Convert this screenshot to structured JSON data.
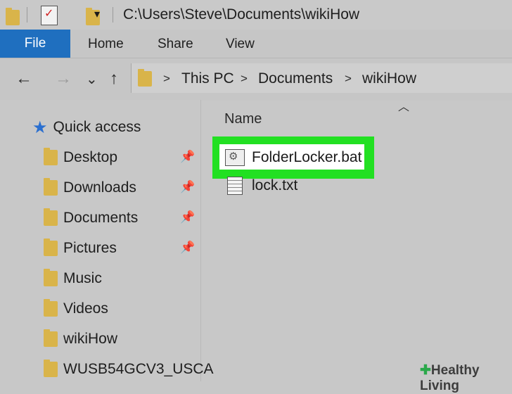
{
  "titlebar": {
    "path": "C:\\Users\\Steve\\Documents\\wikiHow"
  },
  "ribbon": {
    "tabs": [
      "File",
      "Home",
      "Share",
      "View"
    ]
  },
  "navbar": {
    "back": "←",
    "forward": "→",
    "recent": "⌄",
    "up": "↑",
    "breadcrumb": [
      "This PC",
      "Documents",
      "wikiHow"
    ]
  },
  "sidebar": {
    "quick_access": "Quick access",
    "items": [
      {
        "label": "Desktop",
        "icon": "desktop-folder-icon",
        "pinned": true
      },
      {
        "label": "Downloads",
        "icon": "downloads-folder-icon",
        "pinned": true
      },
      {
        "label": "Documents",
        "icon": "documents-folder-icon",
        "pinned": true
      },
      {
        "label": "Pictures",
        "icon": "pictures-folder-icon",
        "pinned": true
      },
      {
        "label": "Music",
        "icon": "music-folder-icon",
        "pinned": false
      },
      {
        "label": "Videos",
        "icon": "videos-folder-icon",
        "pinned": false
      },
      {
        "label": "wikiHow",
        "icon": "folder-icon",
        "pinned": false
      },
      {
        "label": "WUSB54GCV3_USCA",
        "icon": "folder-icon",
        "pinned": false
      }
    ]
  },
  "main": {
    "column_header": "Name",
    "files": [
      {
        "name": "FolderLocker.bat",
        "icon": "batch-file-icon",
        "highlighted": true
      },
      {
        "name": "lock.txt",
        "icon": "text-file-icon",
        "highlighted": false
      }
    ]
  },
  "colors": {
    "file_tab": "#1f6fbf",
    "highlight": "#22e022"
  },
  "watermark": {
    "text": "Healthy Living"
  }
}
